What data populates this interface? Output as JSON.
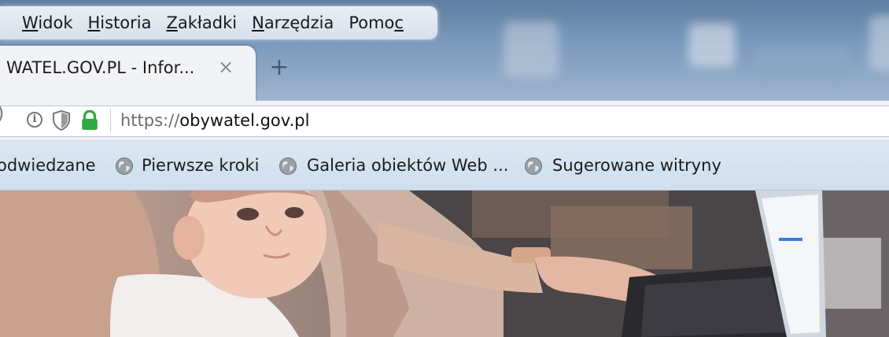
{
  "menubar": {
    "items": [
      {
        "label": "Widok",
        "underline_index": 0
      },
      {
        "label": "Historia",
        "underline_index": 0
      },
      {
        "label": "Zakładki",
        "underline_index": 0
      },
      {
        "label": "Narzędzia",
        "underline_index": 0
      },
      {
        "label": "Pomoc",
        "underline_index": 4
      }
    ]
  },
  "tab": {
    "title": "WATEL.GOV.PL - Infor...",
    "close_glyph": "×",
    "new_tab_glyph": "+"
  },
  "navbar": {
    "info_glyph": "i",
    "url_scheme": "https://",
    "url_domain": "obywatel.gov.pl",
    "icons": [
      "info-icon",
      "tracking-shield-icon",
      "secure-lock-icon"
    ],
    "lock_color": "#2fa844"
  },
  "bookmarks": {
    "items": [
      {
        "label": "odwiedzane",
        "icon": "none"
      },
      {
        "label": "Pierwsze kroki",
        "icon": "globe-icon"
      },
      {
        "label": "Galeria obiektów Web ...",
        "icon": "globe-icon"
      },
      {
        "label": "Sugerowane witryny",
        "icon": "globe-icon"
      }
    ]
  },
  "hero": {
    "image": "photo of a baby on a woman's lap while she types on a laptop"
  },
  "colors": {
    "titlebar": "#6f8db0",
    "menubar": "#e3e9f0",
    "tab": "#f1f3f6",
    "bookmarks_bar": "#d4e2f1"
  }
}
